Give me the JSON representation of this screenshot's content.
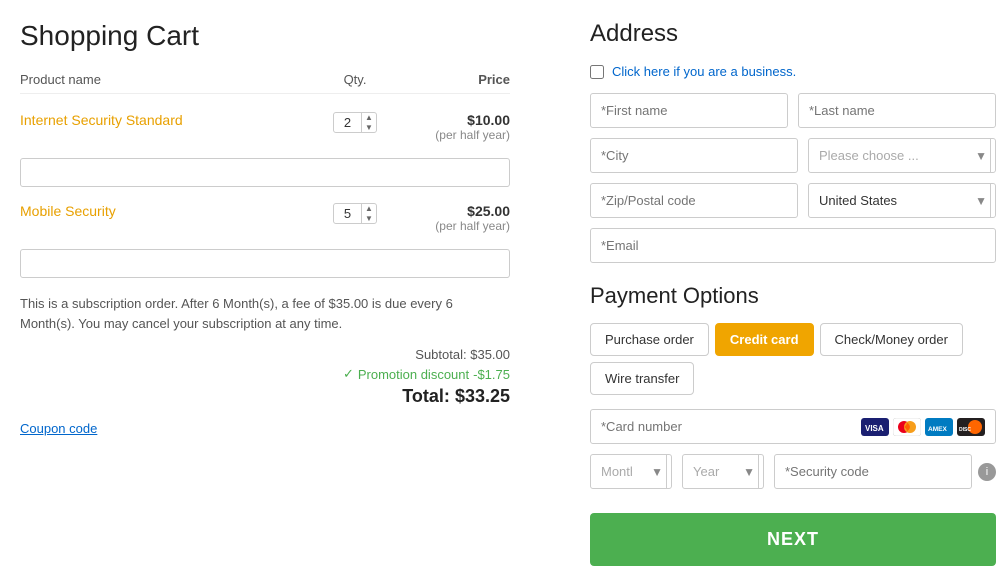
{
  "leftCol": {
    "title": "Shopping Cart",
    "tableHeaders": {
      "product": "Product name",
      "qty": "Qty.",
      "price": "Price"
    },
    "items": [
      {
        "name": "Internet Security Standard",
        "qty": "2",
        "priceMain": "$10.00",
        "priceSub": "(per half year)",
        "promoPlaceholder": ""
      },
      {
        "name": "Mobile Security",
        "qty": "5",
        "priceMain": "$25.00",
        "priceSub": "(per half year)",
        "promoPlaceholder": ""
      }
    ],
    "subscriptionNote": "This is a subscription order. After 6 Month(s), a fee of $35.00 is due every 6 Month(s). You may cancel your subscription at any time.",
    "subtotalLabel": "Subtotal:",
    "subtotalValue": "$35.00",
    "discountLabel": "Promotion discount",
    "discountValue": "-$1.75",
    "totalLabel": "Total:",
    "totalValue": "$33.25",
    "couponLink": "Coupon code"
  },
  "rightCol": {
    "addressTitle": "Address",
    "businessLabel": "Click here if you are a business.",
    "firstNamePlaceholder": "*First name",
    "lastNamePlaceholder": "*Last name",
    "cityPlaceholder": "*City",
    "stateLabel": "Please choose ...",
    "zipPlaceholder": "*Zip/Postal code",
    "countryLabel": "United States",
    "emailPlaceholder": "*Email",
    "paymentTitle": "Payment Options",
    "paymentButtons": [
      {
        "label": "Purchase order",
        "active": false
      },
      {
        "label": "Credit card",
        "active": true
      },
      {
        "label": "Check/Money order",
        "active": false
      },
      {
        "label": "Wire transfer",
        "active": false
      }
    ],
    "cardNumberPlaceholder": "*Card number",
    "monthLabel": "Month",
    "yearLabel": "Year",
    "securityPlaceholder": "*Security code",
    "nextButton": "NEXT",
    "cardIconColors": {
      "visa": "#1a1f71",
      "mastercard": "#eb001b",
      "amex": "#007bc1",
      "discover": "#ff6600"
    }
  }
}
